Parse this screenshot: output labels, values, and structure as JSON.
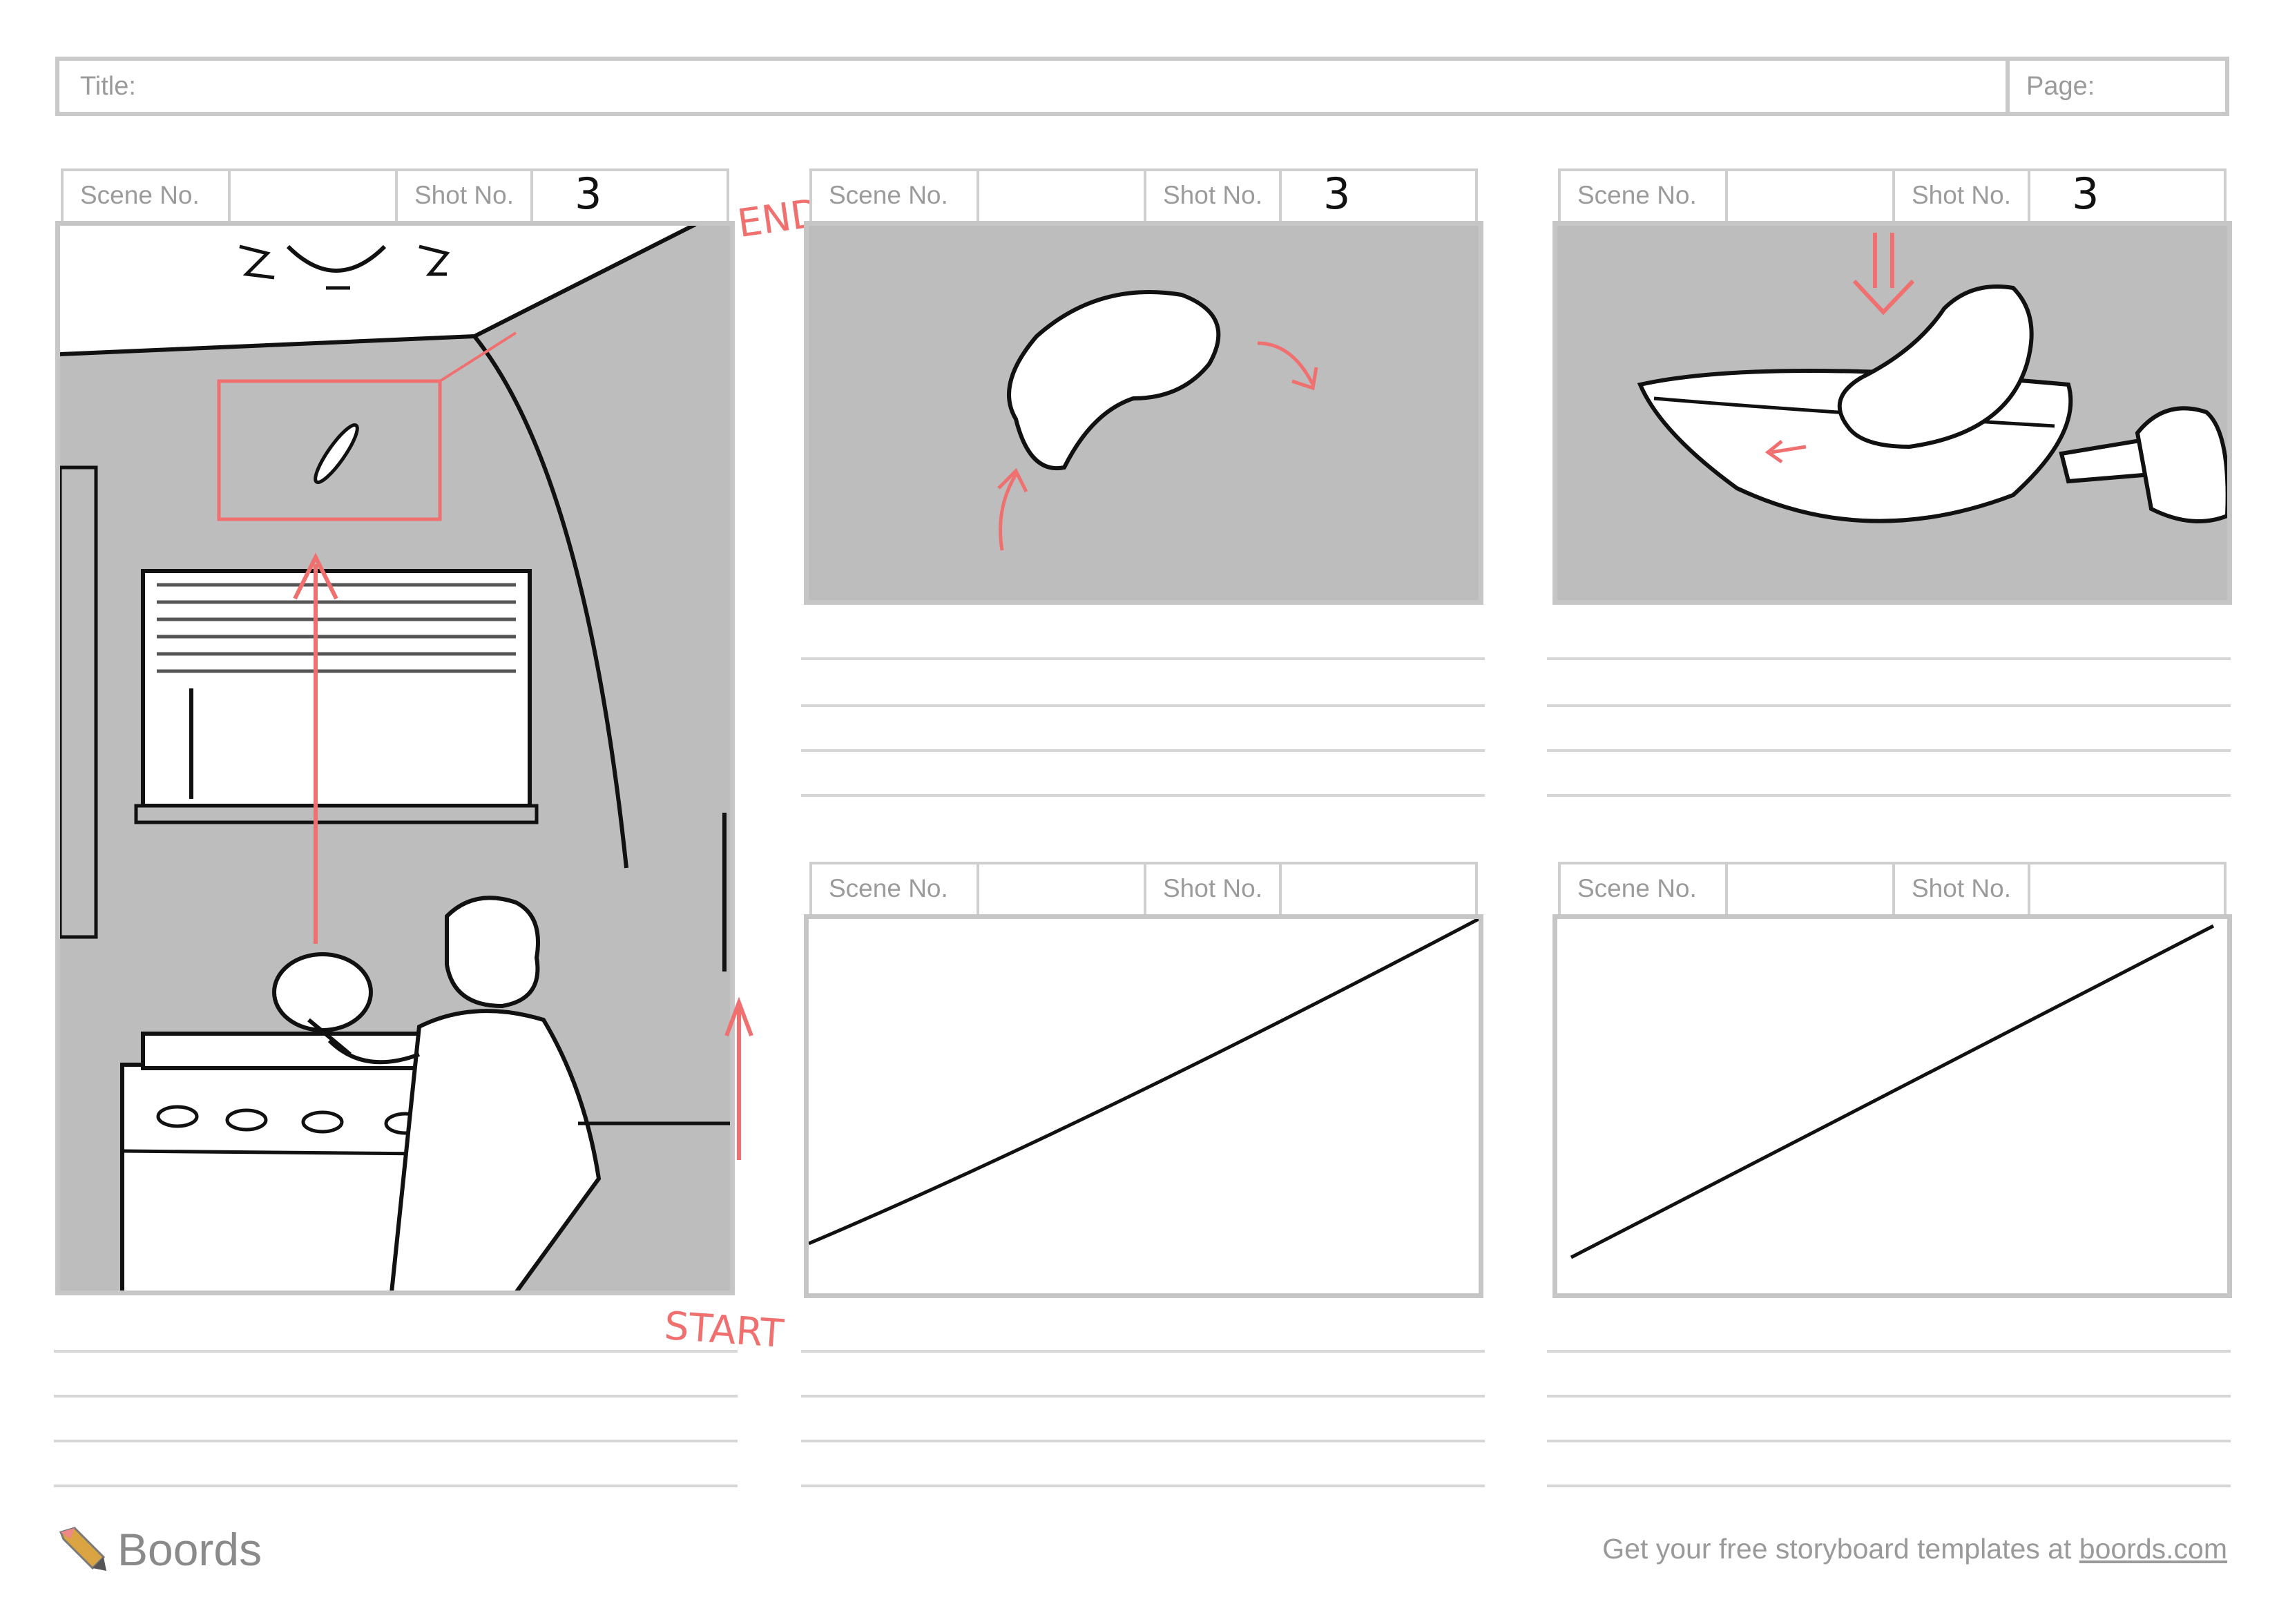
{
  "header": {
    "title_label": "Title:",
    "page_label": "Page:"
  },
  "panels": [
    {
      "scene_label": "Scene No.",
      "shot_label": "Shot No.",
      "shot_value": "3"
    },
    {
      "scene_label": "Scene No.",
      "shot_label": "Shot No.",
      "shot_value": "3"
    },
    {
      "scene_label": "Scene No.",
      "shot_label": "Shot No.",
      "shot_value": "3"
    },
    {
      "scene_label": "Scene No.",
      "shot_label": "Shot No.",
      "shot_value": ""
    },
    {
      "scene_label": "Scene No.",
      "shot_label": "Shot No.",
      "shot_value": ""
    }
  ],
  "annotations": {
    "end": "END",
    "start": "START"
  },
  "footer": {
    "brand": "Boords",
    "tagline": "Get your free storyboard templates at",
    "link_text": "boords.com"
  },
  "colors": {
    "panel_gray": "#bdbdbd",
    "border": "#c6c6c6",
    "annotation_red": "#f07070"
  }
}
